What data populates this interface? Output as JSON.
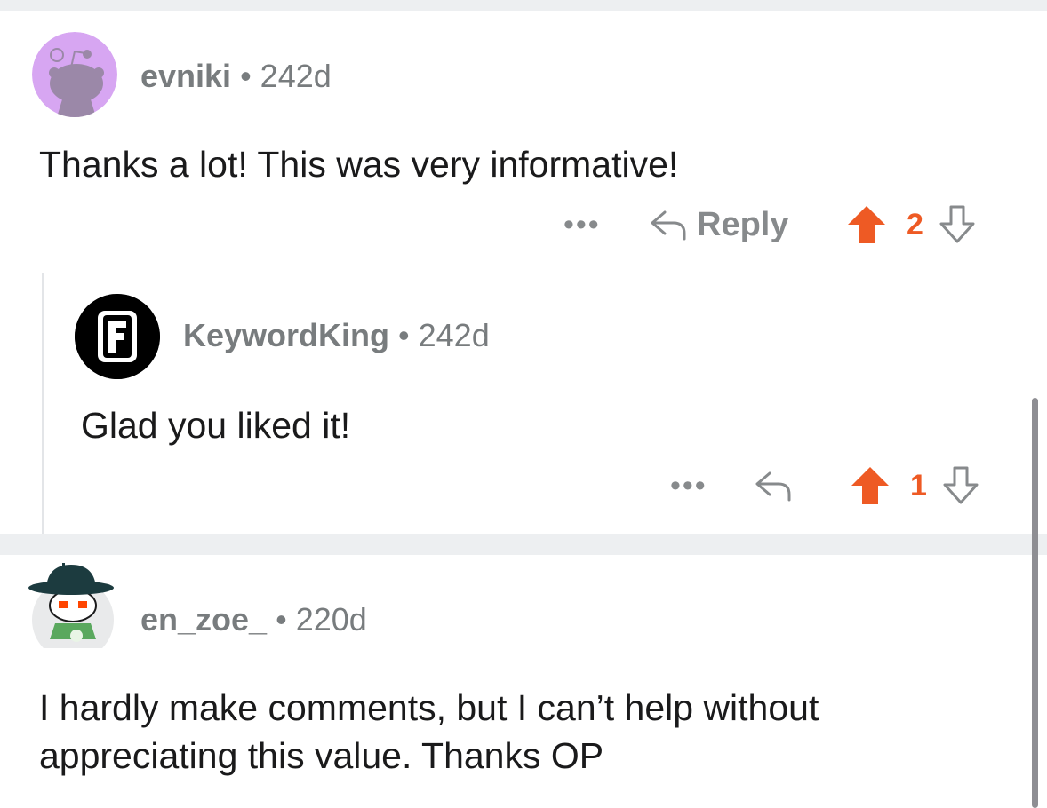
{
  "colors": {
    "upvote": "#ee5a24",
    "muted": "#787c7e",
    "divider": "#edeff1",
    "text": "#1a1a1b"
  },
  "comments": [
    {
      "username": "evniki",
      "separator": "•",
      "age": "242d",
      "text": "Thanks a lot! This was very informative!",
      "more_label": "•••",
      "reply_label": "Reply",
      "score": "2",
      "avatar_icon": "snoo-avatar-purple-icon"
    },
    {
      "username": "KeywordKing",
      "separator": "•",
      "age": "242d",
      "text": "Glad you liked it!",
      "more_label": "•••",
      "score": "1",
      "avatar_letter": "F",
      "avatar_icon": "letter-f-avatar-icon"
    },
    {
      "username": "en_zoe_",
      "separator": "•",
      "age": "220d",
      "text": "I hardly make comments, but I can’t help without appreciating this value. Thanks OP",
      "avatar_icon": "snoo-avatar-hat-icon"
    }
  ]
}
